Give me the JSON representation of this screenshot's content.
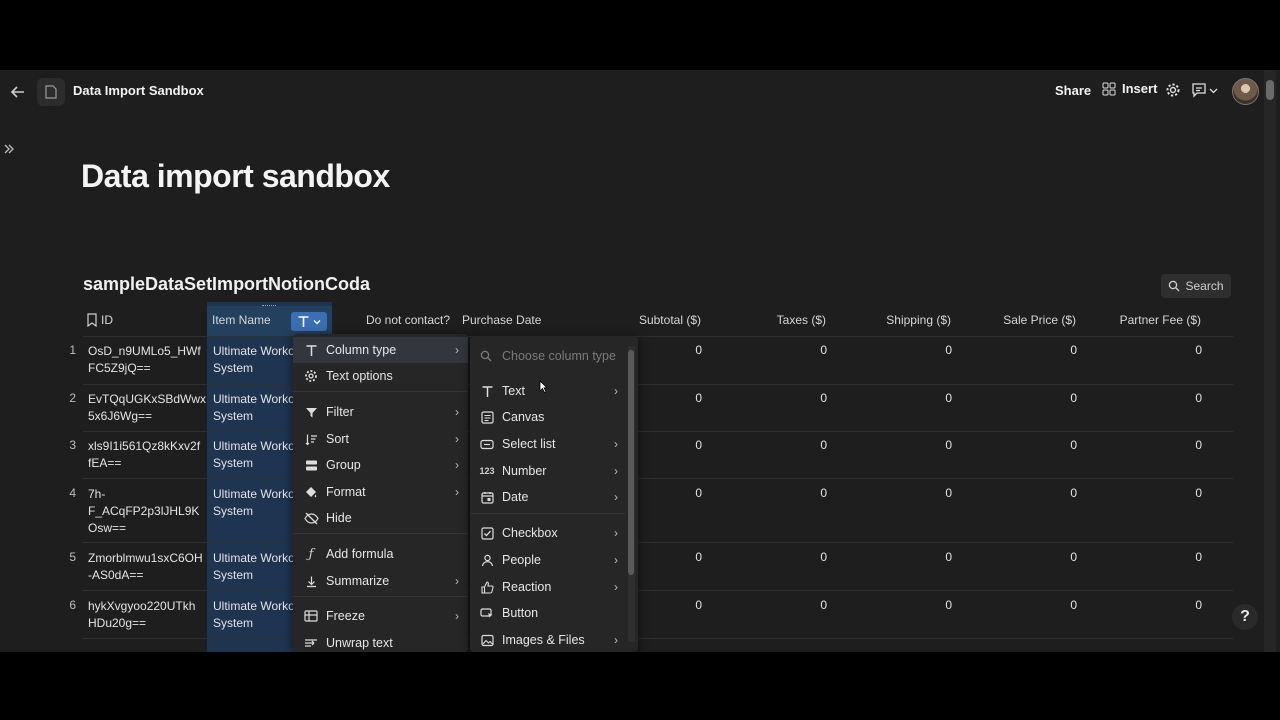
{
  "topbar": {
    "title": "Data Import Sandbox",
    "share_label": "Share",
    "insert_label": "Insert"
  },
  "page_title": "Data import sandbox",
  "table": {
    "title": "sampleDataSetImportNotionCoda",
    "search_label": "Search",
    "columns": [
      "ID",
      "Item Name",
      "Do not contact?",
      "Purchase Date",
      "Subtotal ($)",
      "Taxes ($)",
      "Shipping ($)",
      "Sale Price ($)",
      "Partner Fee ($)"
    ],
    "rows": [
      {
        "num": "1",
        "id": [
          "OsD_n9UMLo5_HWf",
          "FC5Z9jQ=="
        ],
        "item": [
          "Ultimate Worko",
          "System"
        ],
        "vals": [
          "0",
          "0",
          "0",
          "0",
          "0"
        ]
      },
      {
        "num": "2",
        "id": [
          "EvTQqUGKxSBdWwx",
          "5x6J6Wg=="
        ],
        "item": [
          "Ultimate Worko",
          "System"
        ],
        "vals": [
          "0",
          "0",
          "0",
          "0",
          "0"
        ]
      },
      {
        "num": "3",
        "id": [
          "xls9I1i561Qz8kKxv2f",
          "fEA=="
        ],
        "item": [
          "Ultimate Worko",
          "System"
        ],
        "vals": [
          "0",
          "0",
          "0",
          "0",
          "0"
        ]
      },
      {
        "num": "4",
        "id": [
          "7h-",
          "F_ACqFP2p3lJHL9K",
          "Osw=="
        ],
        "item": [
          "Ultimate Worko",
          "System"
        ],
        "vals": [
          "0",
          "0",
          "0",
          "0",
          "0"
        ]
      },
      {
        "num": "5",
        "id": [
          "Zmorblmwu1sxC6OH",
          "-AS0dA=="
        ],
        "item": [
          "Ultimate Worko",
          "System"
        ],
        "vals": [
          "0",
          "0",
          "0",
          "0",
          "0"
        ]
      },
      {
        "num": "6",
        "id": [
          "hykXvgyoo220UTkh",
          "HDu20g=="
        ],
        "item": [
          "Ultimate Worko",
          "System"
        ],
        "vals": [
          "0",
          "0",
          "0",
          "0",
          "0"
        ]
      }
    ]
  },
  "column_menu": {
    "items": [
      "Column type",
      "Text options",
      "Filter",
      "Sort",
      "Group",
      "Format",
      "Hide",
      "Add formula",
      "Summarize",
      "Freeze",
      "Unwrap text"
    ]
  },
  "type_menu": {
    "placeholder": "Choose column type",
    "items": [
      "Text",
      "Canvas",
      "Select list",
      "Number",
      "Date",
      "Checkbox",
      "People",
      "Reaction",
      "Button",
      "Images & Files"
    ]
  },
  "help_label": "?"
}
